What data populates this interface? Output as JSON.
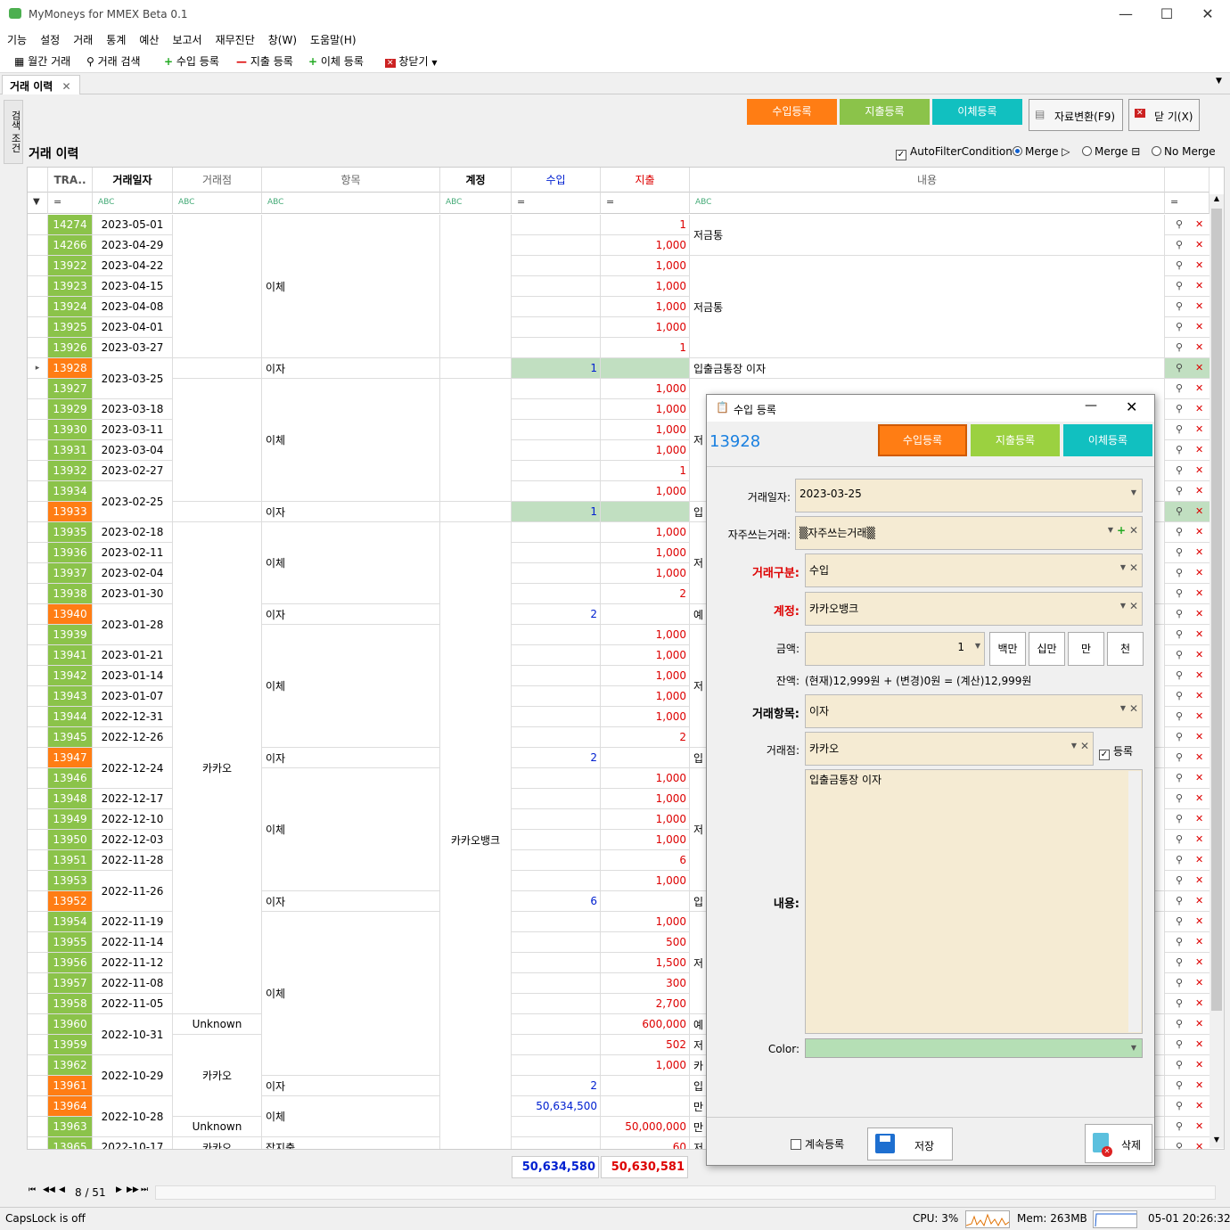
{
  "app": {
    "title": "MyMoneys for MMEX Beta 0.1"
  },
  "menu": [
    "기능",
    "설정",
    "거래",
    "통계",
    "예산",
    "보고서",
    "재무진단",
    "창(W)",
    "도움말(H)"
  ],
  "toolbar": {
    "monthly": "월간 거래",
    "search": "거래 검색",
    "income": "수입 등록",
    "expense": "지출 등록",
    "transfer": "이체 등록",
    "close": "창닫기"
  },
  "tab": {
    "label": "거래 이력",
    "side": "검색 조건"
  },
  "actions": {
    "income": "수입등록",
    "expense": "지출등록",
    "transfer": "이체등록",
    "convert": "자료변환(F9)",
    "close": "닫 기(X)"
  },
  "grid": {
    "title": "거래 이력",
    "options": {
      "autofilter": "AutoFilterCondition",
      "merge_right": "Merge ▷",
      "merge_down": "Merge ⊟",
      "no_merge": "No Merge"
    },
    "columns": {
      "id": "TRA..",
      "date": "거래일자",
      "payee": "거래점",
      "category": "항목",
      "account": "계정",
      "income": "수입",
      "expense": "지출",
      "notes": "내용"
    },
    "rows": [
      {
        "id": "14274",
        "c": "green",
        "date": "2023-05-01",
        "inc": "",
        "exp": "1"
      },
      {
        "id": "14266",
        "c": "green",
        "date": "2023-04-29",
        "inc": "",
        "exp": "1,000"
      },
      {
        "id": "13922",
        "c": "green",
        "date": "2023-04-22",
        "inc": "",
        "exp": "1,000"
      },
      {
        "id": "13923",
        "c": "green",
        "date": "2023-04-15",
        "inc": "",
        "exp": "1,000"
      },
      {
        "id": "13924",
        "c": "green",
        "date": "2023-04-08",
        "inc": "",
        "exp": "1,000"
      },
      {
        "id": "13925",
        "c": "green",
        "date": "2023-04-01",
        "inc": "",
        "exp": "1,000"
      },
      {
        "id": "13926",
        "c": "green",
        "date": "2023-03-27",
        "inc": "",
        "exp": "1"
      },
      {
        "id": "13928",
        "c": "orange",
        "date": "",
        "inc": "1",
        "exp": "",
        "sel": true
      },
      {
        "id": "13927",
        "c": "green",
        "date": "",
        "inc": "",
        "exp": "1,000"
      },
      {
        "id": "13929",
        "c": "green",
        "date": "2023-03-18",
        "inc": "",
        "exp": "1,000"
      },
      {
        "id": "13930",
        "c": "green",
        "date": "2023-03-11",
        "inc": "",
        "exp": "1,000"
      },
      {
        "id": "13931",
        "c": "green",
        "date": "2023-03-04",
        "inc": "",
        "exp": "1,000"
      },
      {
        "id": "13932",
        "c": "green",
        "date": "2023-02-27",
        "inc": "",
        "exp": "1"
      },
      {
        "id": "13934",
        "c": "green",
        "date": "",
        "inc": "",
        "exp": "1,000"
      },
      {
        "id": "13933",
        "c": "orange",
        "date": "",
        "inc": "1",
        "exp": "",
        "sel2": true
      },
      {
        "id": "13935",
        "c": "green",
        "date": "2023-02-18",
        "inc": "",
        "exp": "1,000"
      },
      {
        "id": "13936",
        "c": "green",
        "date": "2023-02-11",
        "inc": "",
        "exp": "1,000"
      },
      {
        "id": "13937",
        "c": "green",
        "date": "2023-02-04",
        "inc": "",
        "exp": "1,000"
      },
      {
        "id": "13938",
        "c": "green",
        "date": "2023-01-30",
        "inc": "",
        "exp": "2"
      },
      {
        "id": "13940",
        "c": "orange",
        "date": "",
        "inc": "2",
        "exp": ""
      },
      {
        "id": "13939",
        "c": "green",
        "date": "",
        "inc": "",
        "exp": "1,000"
      },
      {
        "id": "13941",
        "c": "green",
        "date": "2023-01-21",
        "inc": "",
        "exp": "1,000"
      },
      {
        "id": "13942",
        "c": "green",
        "date": "2023-01-14",
        "inc": "",
        "exp": "1,000"
      },
      {
        "id": "13943",
        "c": "green",
        "date": "2023-01-07",
        "inc": "",
        "exp": "1,000"
      },
      {
        "id": "13944",
        "c": "green",
        "date": "2022-12-31",
        "inc": "",
        "exp": "1,000"
      },
      {
        "id": "13945",
        "c": "green",
        "date": "2022-12-26",
        "inc": "",
        "exp": "2"
      },
      {
        "id": "13947",
        "c": "orange",
        "date": "",
        "inc": "2",
        "exp": ""
      },
      {
        "id": "13946",
        "c": "green",
        "date": "",
        "inc": "",
        "exp": "1,000"
      },
      {
        "id": "13948",
        "c": "green",
        "date": "2022-12-17",
        "inc": "",
        "exp": "1,000"
      },
      {
        "id": "13949",
        "c": "green",
        "date": "2022-12-10",
        "inc": "",
        "exp": "1,000"
      },
      {
        "id": "13950",
        "c": "green",
        "date": "2022-12-03",
        "inc": "",
        "exp": "1,000"
      },
      {
        "id": "13951",
        "c": "green",
        "date": "2022-11-28",
        "inc": "",
        "exp": "6"
      },
      {
        "id": "13953",
        "c": "green",
        "date": "",
        "inc": "",
        "exp": "1,000"
      },
      {
        "id": "13952",
        "c": "orange",
        "date": "",
        "inc": "6",
        "exp": ""
      },
      {
        "id": "13954",
        "c": "green",
        "date": "2022-11-19",
        "inc": "",
        "exp": "1,000"
      },
      {
        "id": "13955",
        "c": "green",
        "date": "2022-11-14",
        "inc": "",
        "exp": "500"
      },
      {
        "id": "13956",
        "c": "green",
        "date": "2022-11-12",
        "inc": "",
        "exp": "1,500"
      },
      {
        "id": "13957",
        "c": "green",
        "date": "2022-11-08",
        "inc": "",
        "exp": "300"
      },
      {
        "id": "13958",
        "c": "green",
        "date": "2022-11-05",
        "inc": "",
        "exp": "2,700"
      },
      {
        "id": "13960",
        "c": "green",
        "date": "",
        "inc": "",
        "exp": "600,000"
      },
      {
        "id": "13959",
        "c": "green",
        "date": "",
        "inc": "",
        "exp": "502"
      },
      {
        "id": "13962",
        "c": "green",
        "date": "",
        "inc": "",
        "exp": "1,000"
      },
      {
        "id": "13961",
        "c": "orange",
        "date": "",
        "inc": "2",
        "exp": ""
      },
      {
        "id": "13964",
        "c": "orange",
        "date": "",
        "inc": "50,634,500",
        "exp": ""
      },
      {
        "id": "13963",
        "c": "green",
        "date": "",
        "inc": "",
        "exp": "50,000,000"
      },
      {
        "id": "13965",
        "c": "green",
        "date": "2022-10-17",
        "inc": "",
        "exp": "60"
      }
    ],
    "merged_dates": [
      "2023-03-25",
      "2023-02-25",
      "2023-01-28",
      "2022-12-24",
      "2022-11-26",
      "2022-10-31",
      "2022-10-29",
      "2022-10-28"
    ],
    "payees": {
      "kakao": "카카오",
      "unknown": "Unknown"
    },
    "categories": {
      "transfer": "이체",
      "interest": "이자",
      "misc": "잡지출"
    },
    "account": "카카오뱅크",
    "notes": {
      "piggy": "저금통",
      "interest_note": "입출금통장 이자"
    },
    "notes_clipped": [
      "저",
      "저",
      "입",
      "저",
      "예",
      "저",
      "입",
      "저",
      "입",
      "저",
      "예",
      "저",
      "카",
      "입",
      "만",
      "만",
      "저"
    ],
    "totals": {
      "income": "50,634,580",
      "expense": "50,630,581"
    }
  },
  "nav": {
    "page": "8 / 51"
  },
  "status": {
    "caps": "CapsLock is off",
    "cpu": "CPU: 3%",
    "mem": "Mem: 263MB",
    "time": "05-01 20:26:32"
  },
  "dialog": {
    "title": "수입 등록",
    "txn_id": "13928",
    "tabs": {
      "income": "수입등록",
      "expense": "지출등록",
      "transfer": "이체등록"
    },
    "labels": {
      "date": "거래일자:",
      "favorite": "자주쓰는거래:",
      "type": "거래구분:",
      "account": "계정:",
      "amount": "금액:",
      "balance": "잔액:",
      "category": "거래항목:",
      "payee": "거래점:",
      "notes": "내용:",
      "color": "Color:"
    },
    "values": {
      "date": "2023-03-25",
      "favorite": "▒자주쓰는거래▒",
      "type": "수입",
      "account": "카카오뱅크",
      "amount": "1",
      "balance": "(현재)12,999원 + (변경)0원 = (계산)12,999원",
      "category": "이자",
      "payee": "카카오",
      "notes": "입출금통장 이자"
    },
    "amount_buttons": [
      "백만",
      "십만",
      "만",
      "천"
    ],
    "register_label": "등록",
    "continue_label": "계속등록",
    "save": "저장",
    "delete": "삭제"
  }
}
